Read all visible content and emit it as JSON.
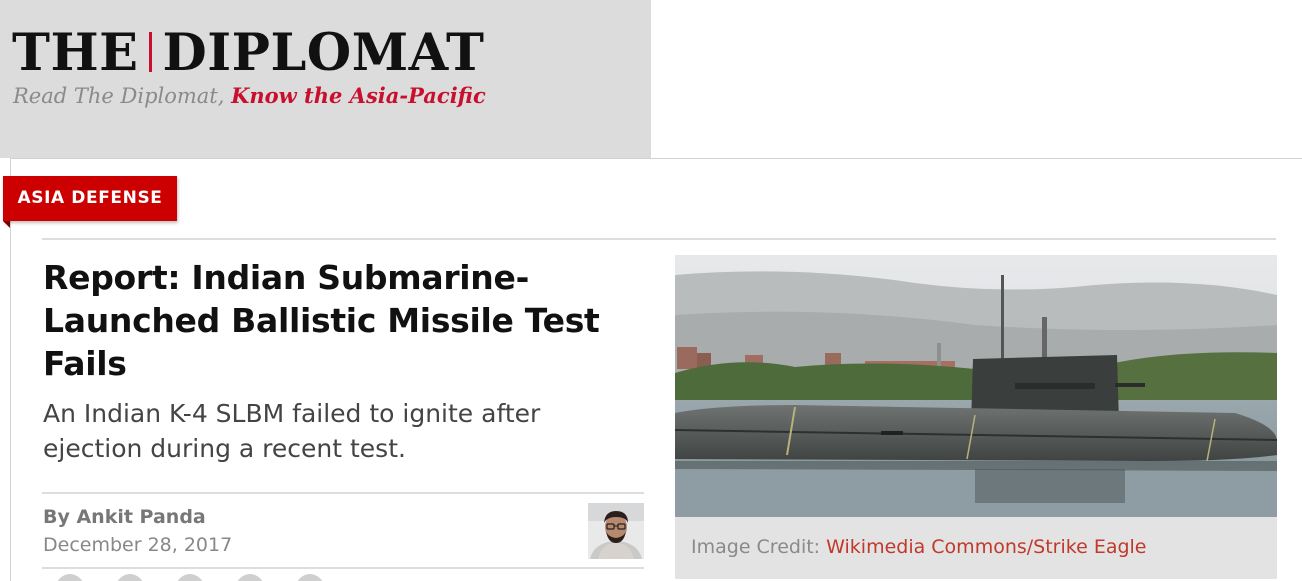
{
  "colors": {
    "brand_red": "#c8102e",
    "tag_red": "#cc0000",
    "link_red": "#c0392b"
  },
  "masthead": {
    "logo_left": "THE",
    "logo_right": "DIPLOMAT",
    "tagline_plain": "Read The Diplomat,",
    "tagline_emphasis": "Know the Asia-Pacific"
  },
  "article": {
    "category": "ASIA DEFENSE",
    "headline": "Report: Indian Submarine-Launched Ballistic Missile Test Fails",
    "dek": "An Indian K-4 SLBM failed to ignite after ejection during a recent test.",
    "byline": "By Ankit Panda",
    "date": "December 28, 2017",
    "author_avatar_icon": "author-photo",
    "share_icons": [
      "facebook-icon",
      "twitter-icon",
      "linkedin-icon",
      "reddit-icon",
      "email-icon"
    ]
  },
  "image": {
    "subject": "submarine-photo",
    "credit_label": "Image Credit:",
    "credit_link": "Wikimedia Commons/Strike Eagle"
  }
}
